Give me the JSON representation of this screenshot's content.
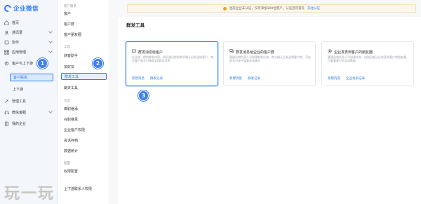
{
  "brand": {
    "name": "企业微信"
  },
  "sidebar": {
    "items": [
      {
        "label": "首页",
        "icon": "home-icon"
      },
      {
        "label": "通讯录",
        "icon": "contacts-icon"
      },
      {
        "label": "协作",
        "icon": "collaborate-icon"
      },
      {
        "label": "应用管理",
        "icon": "apps-icon"
      },
      {
        "label": "客户与上下游",
        "icon": "customer-icon"
      },
      {
        "label": "客户联系",
        "active": true
      },
      {
        "label": "上下游"
      },
      {
        "label": "管理工具",
        "icon": "tools-icon"
      },
      {
        "label": "微信客服",
        "icon": "service-icon"
      },
      {
        "label": "我的企业",
        "icon": "company-icon"
      }
    ]
  },
  "subnav": {
    "groups": [
      {
        "title": "客户联系",
        "items": [
          "客户",
          "客户群",
          "客户朋友圈"
        ]
      },
      {
        "title": "工具",
        "items": [
          "获客助手",
          "加好友",
          "群发工具",
          "聊天工具"
        ]
      },
      {
        "title": "沉淀",
        "items": [
          "离职继承",
          "在职继承",
          "企业客户权限",
          "会话存档",
          "数据统计"
        ]
      },
      {
        "title": "配置",
        "items": [
          "权限配置"
        ]
      }
    ],
    "active_item": "群发工具",
    "bottom_item": "上下游联系人权限"
  },
  "notice": {
    "text": "当前企业未认证，仅可添加100位客户。认证后可提升",
    "link": "前往认证"
  },
  "panel": {
    "title": "群发工具",
    "cards": [
      {
        "icon": "chat-icon",
        "title": "群发消息给客户",
        "desc": "企业统一提供群发内容，成员通过群发助手确认后发送给客户，每位客户每天可接收1条群发消息",
        "actions": [
          "新建消息",
          "群发记录"
        ],
        "highlight": true
      },
      {
        "icon": "group-chat-icon",
        "title": "群发消息给企业的客户群",
        "desc": "管理员和负责人可创建群发任务，群主确认后发送到客户群，可在群发记录中查看发送情况",
        "actions": [
          "新建消息",
          "群发记录"
        ],
        "highlight": false
      },
      {
        "icon": "moments-icon",
        "title": "企业发表到客户的朋友圈",
        "desc": "管理员和负责人可创建任务，由成员确认后发表到客户的朋友圈，可查看客户的互动数据",
        "actions": [
          "新建内容",
          "企业发表记录"
        ],
        "highlight": false
      }
    ]
  },
  "steps": [
    "1",
    "2",
    "3"
  ],
  "watermark": "玩一玩"
}
